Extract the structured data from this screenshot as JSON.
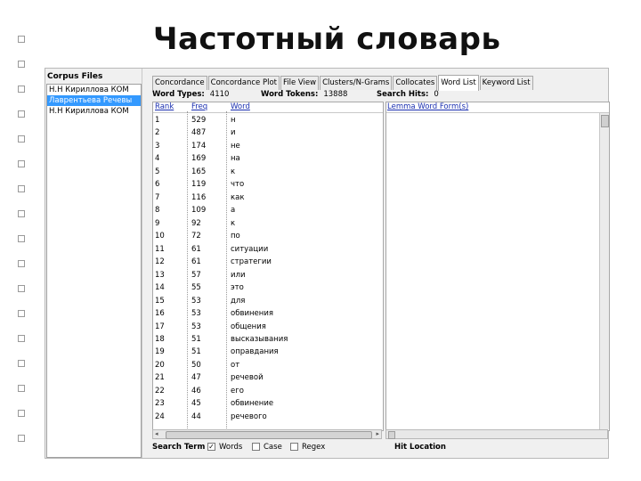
{
  "slide": {
    "title": "Частотный словарь"
  },
  "corpus": {
    "label": "Corpus Files",
    "files": [
      "Н.Н Кириллова КОМ",
      "Лаврентьева Речевы",
      "Н.Н Кириллова КОМ"
    ],
    "selected_index": 1
  },
  "tabs": [
    "Concordance",
    "Concordance Plot",
    "File View",
    "Clusters/N-Grams",
    "Collocates",
    "Word List",
    "Keyword List"
  ],
  "active_tab": "Word List",
  "stats": {
    "word_types_label": "Word Types:",
    "word_types": "4110",
    "word_tokens_label": "Word Tokens:",
    "word_tokens": "13888",
    "search_hits_label": "Search Hits:",
    "search_hits": "0"
  },
  "table": {
    "headers": {
      "rank": "Rank",
      "freq": "Freq",
      "word": "Word"
    },
    "rows": [
      {
        "rank": "1",
        "freq": "529",
        "word": "н"
      },
      {
        "rank": "2",
        "freq": "487",
        "word": "и"
      },
      {
        "rank": "3",
        "freq": "174",
        "word": "не"
      },
      {
        "rank": "4",
        "freq": "169",
        "word": "на"
      },
      {
        "rank": "5",
        "freq": "165",
        "word": "к"
      },
      {
        "rank": "6",
        "freq": "119",
        "word": "что"
      },
      {
        "rank": "7",
        "freq": "116",
        "word": "как"
      },
      {
        "rank": "8",
        "freq": "109",
        "word": "а"
      },
      {
        "rank": "9",
        "freq": "92",
        "word": "к"
      },
      {
        "rank": "10",
        "freq": "72",
        "word": "по"
      },
      {
        "rank": "11",
        "freq": "61",
        "word": "ситуации"
      },
      {
        "rank": "12",
        "freq": "61",
        "word": "стратегии"
      },
      {
        "rank": "13",
        "freq": "57",
        "word": "или"
      },
      {
        "rank": "14",
        "freq": "55",
        "word": "это"
      },
      {
        "rank": "15",
        "freq": "53",
        "word": "для"
      },
      {
        "rank": "16",
        "freq": "53",
        "word": "обвинения"
      },
      {
        "rank": "17",
        "freq": "53",
        "word": "общения"
      },
      {
        "rank": "18",
        "freq": "51",
        "word": "высказывания"
      },
      {
        "rank": "19",
        "freq": "51",
        "word": "оправдания"
      },
      {
        "rank": "20",
        "freq": "50",
        "word": "от"
      },
      {
        "rank": "21",
        "freq": "47",
        "word": "речевой"
      },
      {
        "rank": "22",
        "freq": "46",
        "word": "его"
      },
      {
        "rank": "23",
        "freq": "45",
        "word": "обвинение"
      },
      {
        "rank": "24",
        "freq": "44",
        "word": "речевого"
      }
    ]
  },
  "lemma": {
    "header": "Lemma Word Form(s)"
  },
  "search": {
    "label": "Search Term",
    "options": [
      {
        "label": "Words",
        "checked": true
      },
      {
        "label": "Case",
        "checked": false
      },
      {
        "label": "Regex",
        "checked": false
      }
    ],
    "hit_location": "Hit Location"
  }
}
